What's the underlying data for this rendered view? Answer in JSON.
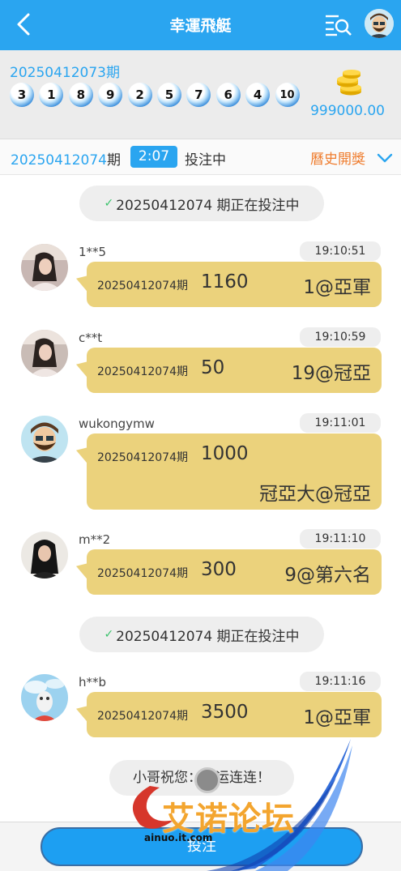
{
  "header": {
    "title": "幸運飛艇",
    "back_icon": "chevron-left-icon",
    "menu_icon": "list-search-icon"
  },
  "last_draw": {
    "issue": "20250412073期",
    "balls": [
      "3",
      "1",
      "8",
      "9",
      "2",
      "5",
      "7",
      "6",
      "4",
      "10"
    ],
    "balance": "999000.00"
  },
  "current": {
    "issue_number": "20250412074",
    "issue_suffix": "期",
    "countdown": "2:07",
    "status": "投注中",
    "history_label": "曆史開獎"
  },
  "chat": {
    "system_messages": [
      {
        "text": "20250412074 期正在投注中"
      },
      {
        "text": "20250412074 期正在投注中"
      }
    ],
    "messages": [
      {
        "user": "1**5",
        "time": "19:10:51",
        "issue": "20250412074期",
        "amount": "1160",
        "pick": "1@亞軍"
      },
      {
        "user": "c**t",
        "time": "19:10:59",
        "issue": "20250412074期",
        "amount": "50",
        "pick": "19@冠亞"
      },
      {
        "user": "wukongymw",
        "time": "19:11:01",
        "issue": "20250412074期",
        "amount": "1000",
        "pick": "冠亞大@冠亞"
      },
      {
        "user": "m**2",
        "time": "19:11:10",
        "issue": "20250412074期",
        "amount": "300",
        "pick": "9@第六名"
      },
      {
        "user": "h**b",
        "time": "19:11:16",
        "issue": "20250412074期",
        "amount": "3500",
        "pick": "1@亞軍"
      }
    ],
    "greeting": "小哥祝您：好运连连！"
  },
  "bottom": {
    "bet_label": "投注"
  },
  "watermark": {
    "text": "艾诺论坛",
    "url": "ainuo.it.com"
  },
  "colors": {
    "primary": "#2aa5f0",
    "bubble": "#ebd27c",
    "history": "#ef7d2f",
    "status_check": "#39c26b"
  }
}
